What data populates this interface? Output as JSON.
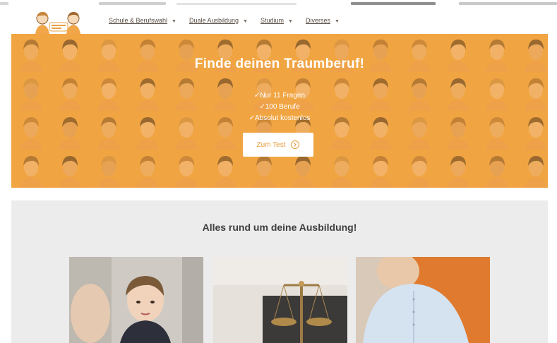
{
  "browser_strip": {},
  "nav": {
    "menu": [
      {
        "label": "Schule & Berufswahl"
      },
      {
        "label": "Duale Ausbildung"
      },
      {
        "label": "Studium"
      },
      {
        "label": "Diverses"
      }
    ],
    "caret_icon": "chevron-down-icon"
  },
  "hero": {
    "title": "Finde deinen Traumberuf!",
    "bullets": [
      "Nur 11 Fragen",
      "100 Berufe",
      "Absolut kostenlos"
    ],
    "button_label": "Zum Test",
    "button_icon": "arrow-right-circle-icon",
    "accent_color": "#f0a94a"
  },
  "section": {
    "title": "Alles rund um deine Ausbildung!",
    "cards": [
      {
        "image": "woman-thinking-photo"
      },
      {
        "image": "justice-scales-photo"
      },
      {
        "image": "man-in-shirt-photo"
      }
    ]
  }
}
